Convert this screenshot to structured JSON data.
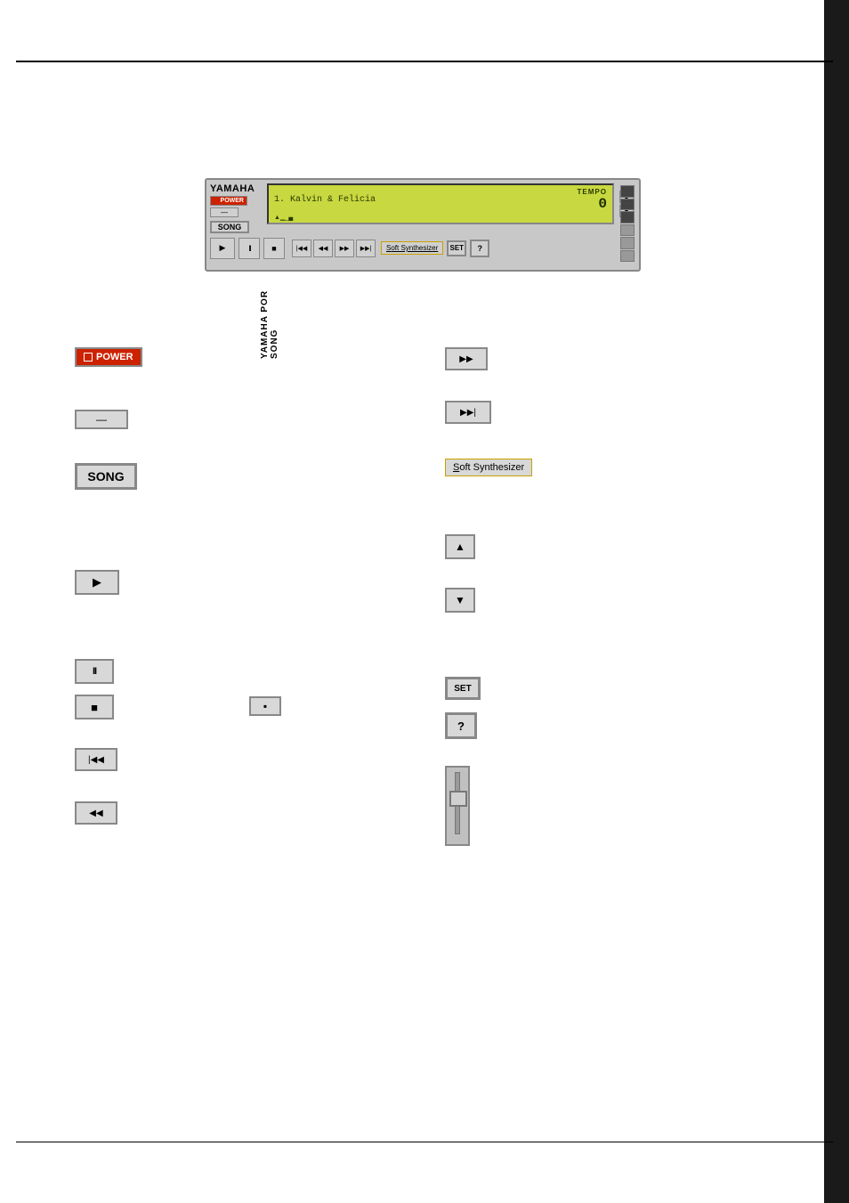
{
  "page": {
    "title": "YAMAHA POR SONG",
    "background": "#ffffff"
  },
  "device": {
    "brand": "YAMAHA",
    "power_btn": "POWER",
    "song_btn": "SONG",
    "lcd": {
      "song_number": "1.",
      "song_name": "Kalvin & Felicia",
      "tempo_label": "TEMPO",
      "tempo_value": "0",
      "waveform": "▲▁_▄"
    },
    "transport": {
      "play": "▶",
      "pause": "II",
      "stop": "■",
      "rewind_to_start": "|◀◀",
      "rewind": "◀◀",
      "fast_forward": "▶▶",
      "fast_forward_to_end": "▶▶|",
      "soft_synthesizer": "Soft Synthesizer",
      "set": "SET",
      "help": "?"
    },
    "tempo_up": "▲",
    "tempo_down": "▼"
  },
  "buttons": {
    "power": {
      "label": "POWER",
      "indicator": "■"
    },
    "minus": {
      "label": "—"
    },
    "song": {
      "label": "SONG"
    },
    "play": {
      "label": "▶"
    },
    "pause": {
      "label": "II"
    },
    "stop": {
      "label": "■"
    },
    "stop_small": {
      "label": "▪"
    },
    "rewind_to_start": {
      "label": "|◀◀"
    },
    "rewind": {
      "label": "◀◀"
    },
    "fast_forward": {
      "label": "▶▶"
    },
    "fast_forward_to_end": {
      "label": "▶▶|"
    },
    "soft_synthesizer": {
      "label": "Soft Synthesizer",
      "underline_char": "S"
    },
    "tempo_up": {
      "label": "▲"
    },
    "tempo_down": {
      "label": "▼"
    },
    "set": {
      "label": "SET"
    },
    "help": {
      "label": "?"
    },
    "slider": {
      "label": "volume slider"
    }
  },
  "yamaha_por_song_text": "YAMAHA POR SONG"
}
